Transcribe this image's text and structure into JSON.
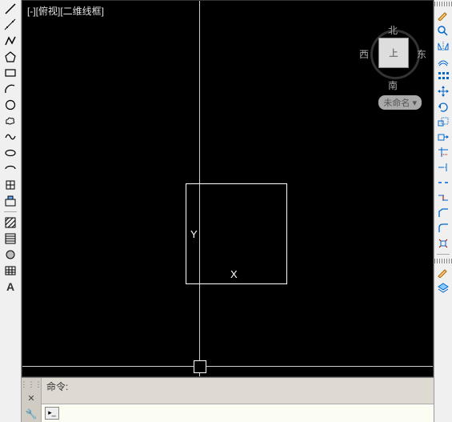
{
  "view": {
    "label": "[-][俯视][二维线框]"
  },
  "axes": {
    "x": "X",
    "y": "Y"
  },
  "navcube": {
    "face": "上",
    "north": "北",
    "south": "南",
    "east": "东",
    "west": "西",
    "tag": "未命名 ▾"
  },
  "command": {
    "history": "命令:",
    "prompt_icon": "▸_",
    "input_value": ""
  },
  "left_tools": [
    "line",
    "construction-line",
    "polyline",
    "polygon",
    "rectangle",
    "arc",
    "circle",
    "revision-cloud",
    "spline",
    "ellipse",
    "ellipse-arc",
    "insert-block",
    "make-block",
    "point",
    "hatch",
    "gradient",
    "region",
    "table",
    "text"
  ],
  "right_tools": [
    "distance",
    "quick-select",
    "mirror",
    "offset",
    "array",
    "move",
    "rotate",
    "scale",
    "stretch",
    "trim",
    "extend",
    "break",
    "join",
    "chamfer",
    "fillet",
    "explode",
    "brush",
    "layer"
  ]
}
